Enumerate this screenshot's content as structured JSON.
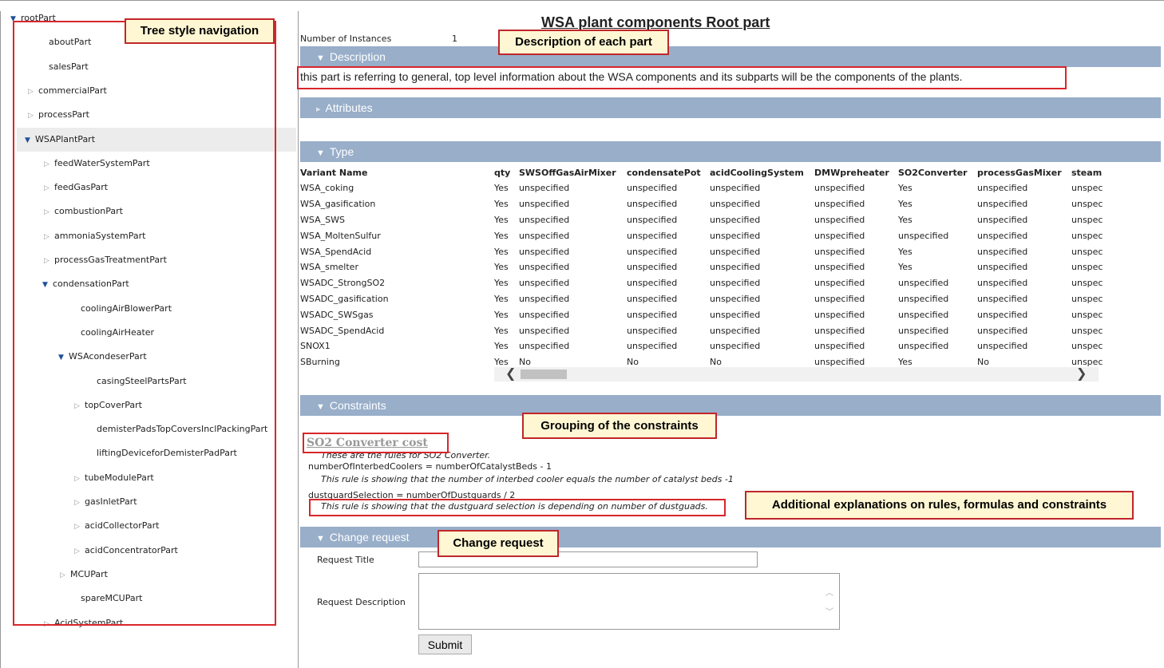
{
  "tree": {
    "items": [
      {
        "label": "rootPart",
        "toggle": "open"
      },
      {
        "label": "aboutPart",
        "toggle": ""
      },
      {
        "label": "salesPart",
        "toggle": ""
      },
      {
        "label": "commercialPart",
        "toggle": "closed"
      },
      {
        "label": "processPart",
        "toggle": "closed"
      },
      {
        "label": "WSAPlantPart",
        "toggle": "open"
      },
      {
        "label": "feedWaterSystemPart",
        "toggle": "closed"
      },
      {
        "label": "feedGasPart",
        "toggle": "closed"
      },
      {
        "label": "combustionPart",
        "toggle": "closed"
      },
      {
        "label": "ammoniaSystemPart",
        "toggle": "closed"
      },
      {
        "label": "processGasTreatmentPart",
        "toggle": "closed"
      },
      {
        "label": "condensationPart",
        "toggle": "open"
      },
      {
        "label": "coolingAirBlowerPart",
        "toggle": ""
      },
      {
        "label": "coolingAirHeater",
        "toggle": ""
      },
      {
        "label": "WSAcondeserPart",
        "toggle": "open"
      },
      {
        "label": "casingSteelPartsPart",
        "toggle": ""
      },
      {
        "label": "topCoverPart",
        "toggle": "closed"
      },
      {
        "label": "demisterPadsTopCoversInclPackingPart",
        "toggle": ""
      },
      {
        "label": "liftingDeviceforDemisterPadPart",
        "toggle": ""
      },
      {
        "label": "tubeModulePart",
        "toggle": "closed"
      },
      {
        "label": "gasInletPart",
        "toggle": "closed"
      },
      {
        "label": "acidCollectorPart",
        "toggle": "closed"
      },
      {
        "label": "acidConcentratorPart",
        "toggle": "closed"
      },
      {
        "label": "MCUPart",
        "toggle": "closed"
      },
      {
        "label": "spareMCUPart",
        "toggle": ""
      },
      {
        "label": "AcidSystemPart",
        "toggle": "closed"
      }
    ]
  },
  "main": {
    "title": "WSA plant components Root part",
    "instances_label": "Number of Instances",
    "instances_value": "1",
    "description_header": "Description",
    "description_text": "this part is referring to general, top level information about the WSA components and its subparts will be the components of the plants.",
    "attributes_header": "Attributes",
    "type_header": "Type",
    "type_table": {
      "columns": [
        "Variant Name",
        "qty",
        "SWSOffGasAirMixer",
        "condensatePot",
        "acidCoolingSystem",
        "DMWpreheater",
        "SO2Converter",
        "processGasMixer",
        "steam"
      ],
      "rows": [
        [
          "WSA_coking",
          "Yes",
          "unspecified",
          "unspecified",
          "unspecified",
          "unspecified",
          "Yes",
          "unspecified",
          "unspec"
        ],
        [
          "WSA_gasification",
          "Yes",
          "unspecified",
          "unspecified",
          "unspecified",
          "unspecified",
          "Yes",
          "unspecified",
          "unspec"
        ],
        [
          "WSA_SWS",
          "Yes",
          "unspecified",
          "unspecified",
          "unspecified",
          "unspecified",
          "Yes",
          "unspecified",
          "unspec"
        ],
        [
          "WSA_MoltenSulfur",
          "Yes",
          "unspecified",
          "unspecified",
          "unspecified",
          "unspecified",
          "unspecified",
          "unspecified",
          "unspec"
        ],
        [
          "WSA_SpendAcid",
          "Yes",
          "unspecified",
          "unspecified",
          "unspecified",
          "unspecified",
          "Yes",
          "unspecified",
          "unspec"
        ],
        [
          "WSA_smelter",
          "Yes",
          "unspecified",
          "unspecified",
          "unspecified",
          "unspecified",
          "Yes",
          "unspecified",
          "unspec"
        ],
        [
          "WSADC_StrongSO2",
          "Yes",
          "unspecified",
          "unspecified",
          "unspecified",
          "unspecified",
          "unspecified",
          "unspecified",
          "unspec"
        ],
        [
          "WSADC_gasification",
          "Yes",
          "unspecified",
          "unspecified",
          "unspecified",
          "unspecified",
          "unspecified",
          "unspecified",
          "unspec"
        ],
        [
          "WSADC_SWSgas",
          "Yes",
          "unspecified",
          "unspecified",
          "unspecified",
          "unspecified",
          "unspecified",
          "unspecified",
          "unspec"
        ],
        [
          "WSADC_SpendAcid",
          "Yes",
          "unspecified",
          "unspecified",
          "unspecified",
          "unspecified",
          "unspecified",
          "unspecified",
          "unspec"
        ],
        [
          "SNOX1",
          "Yes",
          "unspecified",
          "unspecified",
          "unspecified",
          "unspecified",
          "unspecified",
          "unspecified",
          "unspec"
        ],
        [
          "SBurning",
          "Yes",
          "No",
          "No",
          "No",
          "unspecified",
          "Yes",
          "No",
          "unspec"
        ]
      ]
    },
    "constraints_header": "Constraints",
    "constraint_group_title": "SO2 Converter cost",
    "constraint_intro": "These are the rules for SO2 Converter.",
    "rule1": "numberOfInterbedCoolers = numberOfCatalystBeds - 1",
    "rule1_note": "This rule is showing that the number of interbed cooler equals the number of catalyst beds -1",
    "rule2": "dustguardSelection = numberOfDustguards / 2",
    "rule2_note": "This rule is showing that the dustguard selection is depending on number of dustguads.",
    "change_header": "Change request",
    "request_title_label": "Request Title",
    "request_title_value": "",
    "request_desc_label": "Request Description",
    "request_desc_value": "",
    "submit_label": "Submit"
  },
  "annotations": {
    "tree": "Tree style navigation",
    "description": "Description of each part",
    "grouping": "Grouping of the constraints",
    "explanations": "Additional explanations on rules, formulas and constraints",
    "change": "Change request"
  },
  "colors": {
    "section_bar": "#98aec9",
    "annotation_border": "#c0262b",
    "annotation_fill": "#fff7d3"
  }
}
